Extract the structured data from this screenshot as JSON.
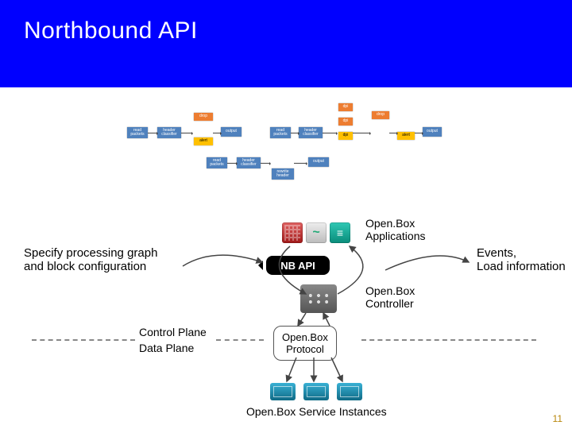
{
  "title": "Northbound API",
  "labels": {
    "specify": "Specify processing graph\nand block configuration",
    "apps": "Open.Box\nApplications",
    "ctrl": "Open.Box\nController",
    "events": "Events,\nLoad information",
    "instances": "Open.Box Service Instances",
    "control_plane": "Control Plane",
    "data_plane": "Data Plane"
  },
  "bubbles": {
    "nbapi": "NB API",
    "protocol": "Open.Box\nProtocol"
  },
  "blocks": {
    "read": "read\npackets",
    "hcls": "header\nclassifier",
    "drop": "drop",
    "alert": "alert",
    "output": "output",
    "dpi": "dpi",
    "rewrite": "rewrite\nheader"
  },
  "page_number": "11",
  "chart_data": {
    "type": "diagram",
    "nodes": [
      {
        "id": "apps",
        "label": "Open.Box Applications",
        "tier": "application"
      },
      {
        "id": "controller",
        "label": "Open.Box Controller",
        "tier": "control"
      },
      {
        "id": "instances",
        "label": "Open.Box Service Instances",
        "tier": "data"
      }
    ],
    "edges": [
      {
        "from": "apps",
        "to": "controller",
        "label": "NB API",
        "direction": "down",
        "carries": "Specify processing graph and block configuration"
      },
      {
        "from": "controller",
        "to": "apps",
        "label": "NB API",
        "direction": "up",
        "carries": "Events, Load information"
      },
      {
        "from": "controller",
        "to": "instances",
        "label": "Open.Box Protocol",
        "direction": "both"
      }
    ],
    "plane_boundary": {
      "above": "Control Plane",
      "below": "Data Plane"
    },
    "example_processing_graphs": [
      {
        "chain": [
          "read packets",
          "header classifier",
          "drop",
          "alert",
          "output"
        ]
      },
      {
        "chain": [
          "read packets",
          "header classifier",
          "dpi",
          "drop",
          "alert",
          "output"
        ]
      },
      {
        "chain": [
          "read packets",
          "header classifier",
          "rewrite header",
          "output"
        ]
      }
    ]
  }
}
